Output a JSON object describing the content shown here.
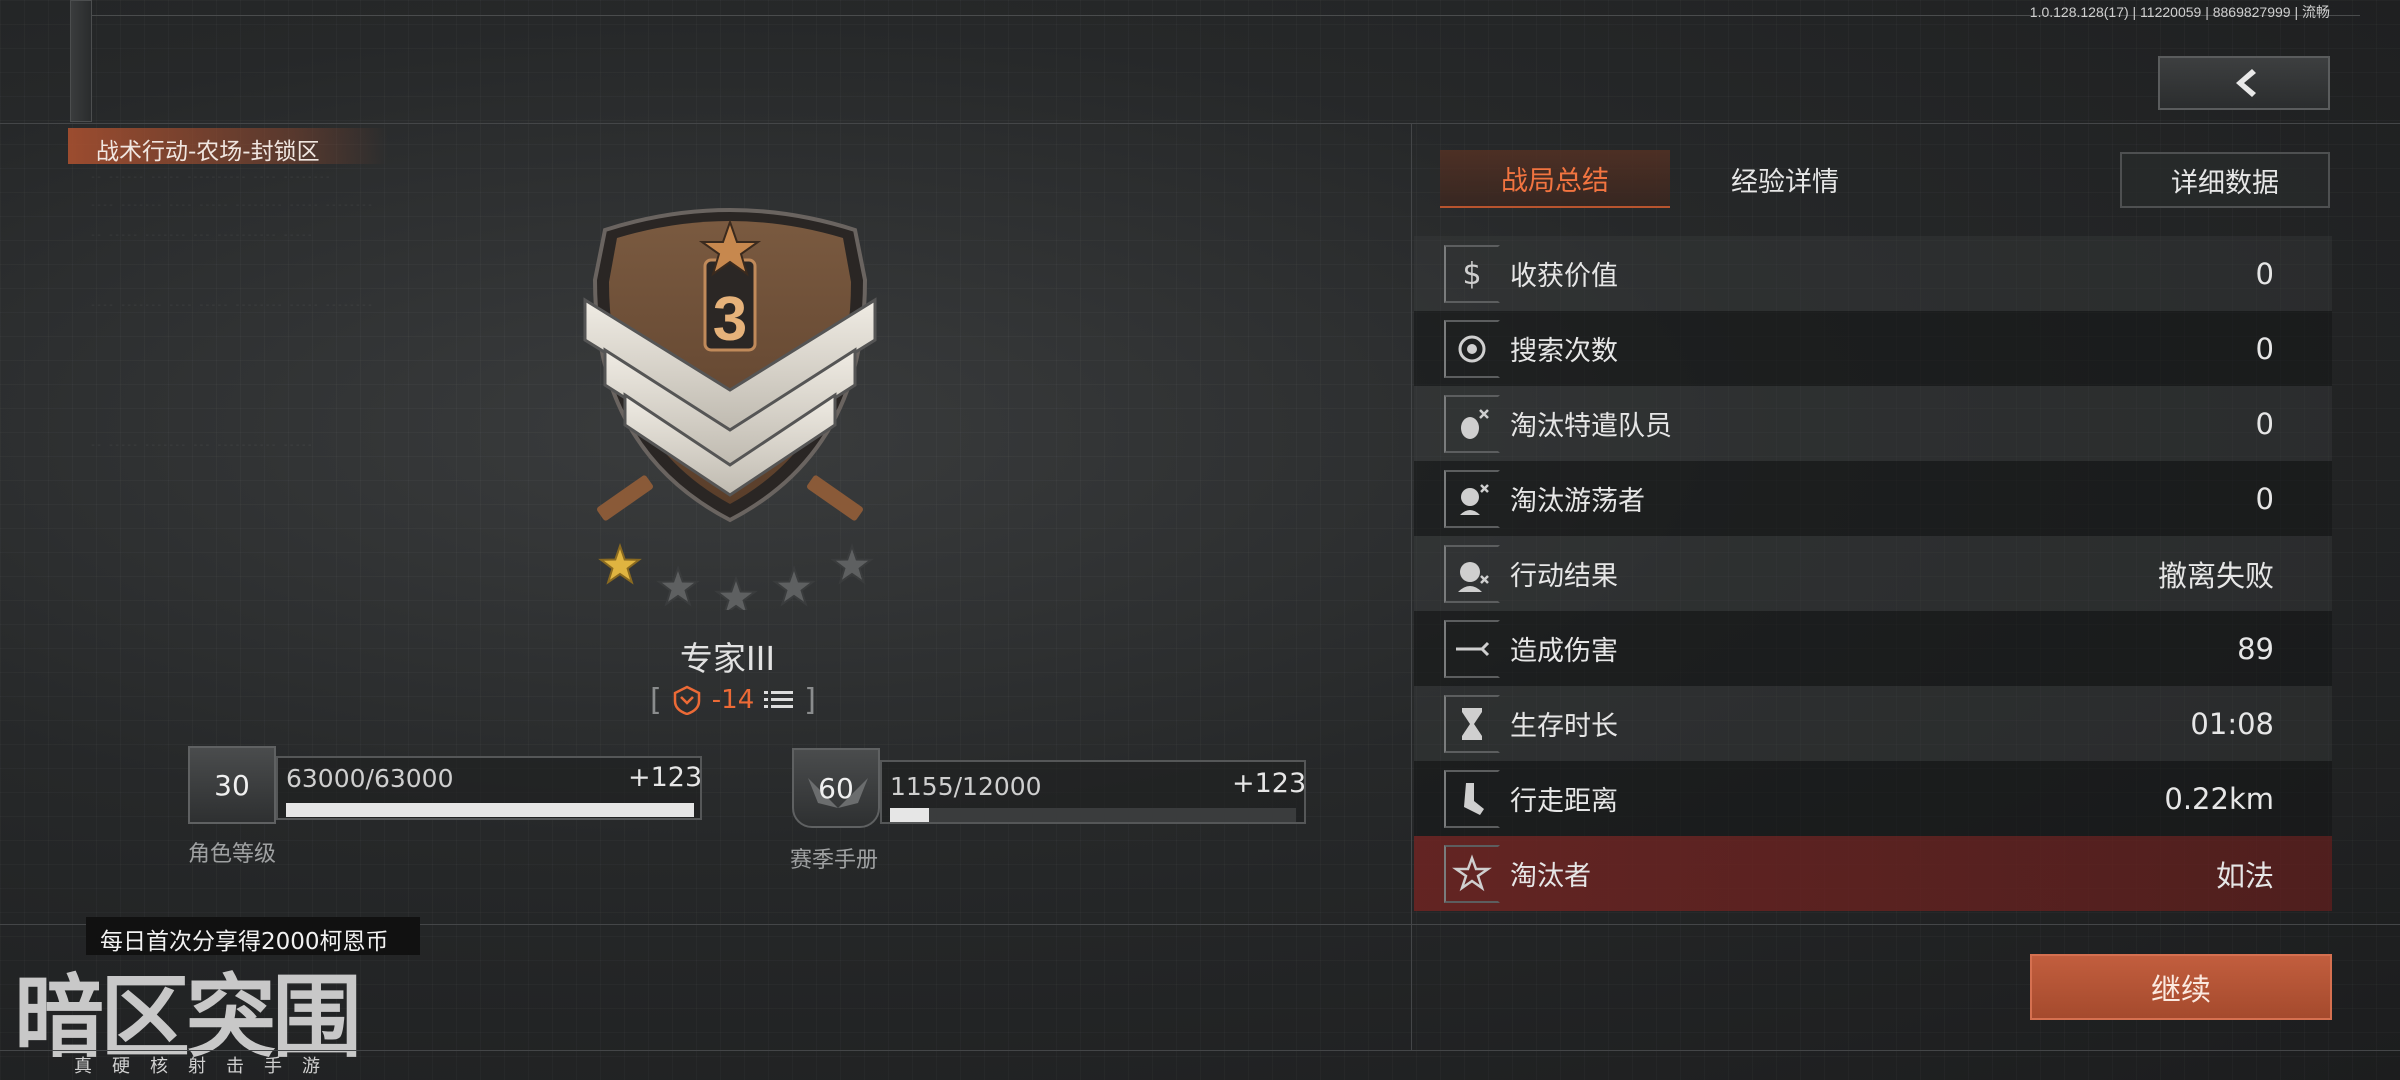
{
  "version": "1.0.128.128(17) | 11220059 | 8869827999 | 流畅",
  "mode_title": "战术行动-农场-封锁区",
  "rank": {
    "name": "专家III",
    "change": "-14",
    "stars_filled": 1,
    "stars_total": 5,
    "emblem_number": "3"
  },
  "role_level": {
    "level": "30",
    "xp": "63000/63000",
    "gain": "+123",
    "label": "角色等级",
    "progress": 1.0
  },
  "season_book": {
    "level": "60",
    "xp": "1155/12000",
    "gain": "+123",
    "label": "赛季手册",
    "progress": 0.096
  },
  "share_banner": "每日首次分享得2000柯恩币",
  "logo": {
    "title": "暗区突围",
    "subtitle": "真硬核射击手游"
  },
  "tabs": {
    "summary": "战局总结",
    "experience": "经验详情",
    "detail": "详细数据"
  },
  "stats": [
    {
      "icon": "dollar-icon",
      "label": "收获价值",
      "value": "0"
    },
    {
      "icon": "search-icon",
      "label": "搜索次数",
      "value": "0"
    },
    {
      "icon": "eliminate-operator-icon",
      "label": "淘汰特遣队员",
      "value": "0"
    },
    {
      "icon": "eliminate-wanderer-icon",
      "label": "淘汰游荡者",
      "value": "0"
    },
    {
      "icon": "mission-result-icon",
      "label": "行动结果",
      "value": "撤离失败"
    },
    {
      "icon": "damage-icon",
      "label": "造成伤害",
      "value": "89"
    },
    {
      "icon": "hourglass-icon",
      "label": "生存时长",
      "value": "01:08"
    },
    {
      "icon": "walking-icon",
      "label": "行走距离",
      "value": "0.22km"
    },
    {
      "icon": "killer-star-icon",
      "label": "淘汰者",
      "value": "如法"
    }
  ],
  "continue_label": "继续",
  "colors": {
    "accent": "#f27440",
    "button": "#b8542e",
    "highlight_row": "#6e2422"
  }
}
